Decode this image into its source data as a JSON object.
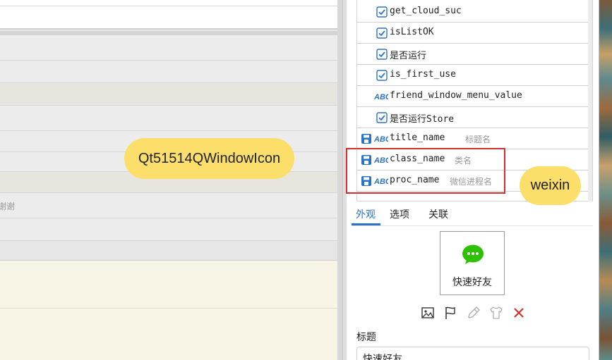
{
  "left_pane": {
    "fragment_text": "谢谢"
  },
  "variables": {
    "items": [
      {
        "type": "checkbox",
        "name": "get_cloud_suc",
        "desc": ""
      },
      {
        "type": "checkbox",
        "name": "isListOK",
        "desc": ""
      },
      {
        "type": "checkbox",
        "name": "是否运行",
        "desc": ""
      },
      {
        "type": "checkbox",
        "name": "is_first_use",
        "desc": ""
      },
      {
        "type": "text",
        "name": "friend_window_menu_value",
        "desc": ""
      },
      {
        "type": "checkbox",
        "name": "是否运行Store",
        "desc": ""
      },
      {
        "type": "saved-text",
        "name": "title_name",
        "desc": "标题名"
      },
      {
        "type": "saved-text",
        "name": "class_name",
        "desc": "类名"
      },
      {
        "type": "saved-text",
        "name": "proc_name",
        "desc": "微信进程名"
      }
    ],
    "abc_glyph": "ABC"
  },
  "tabs": [
    {
      "label": "外观",
      "active": true
    },
    {
      "label": "选项",
      "active": false
    },
    {
      "label": "关联",
      "active": false
    }
  ],
  "appearance": {
    "preview_label": "快速好友",
    "preview_icon": "wechat-icon",
    "tools": [
      "image-icon",
      "flag-icon",
      "eyedropper-icon",
      "shirt-icon",
      "close-icon"
    ]
  },
  "title_field": {
    "label": "标题",
    "value": "快速好友"
  },
  "annotations": {
    "window_class_callout": "Qt51514QWindowIcon",
    "process_callout": "weixin"
  },
  "colors": {
    "accent": "#2b73c9",
    "highlight": "#d32f2f",
    "callout": "#fcde6a",
    "wechat_green": "#2dc100"
  }
}
